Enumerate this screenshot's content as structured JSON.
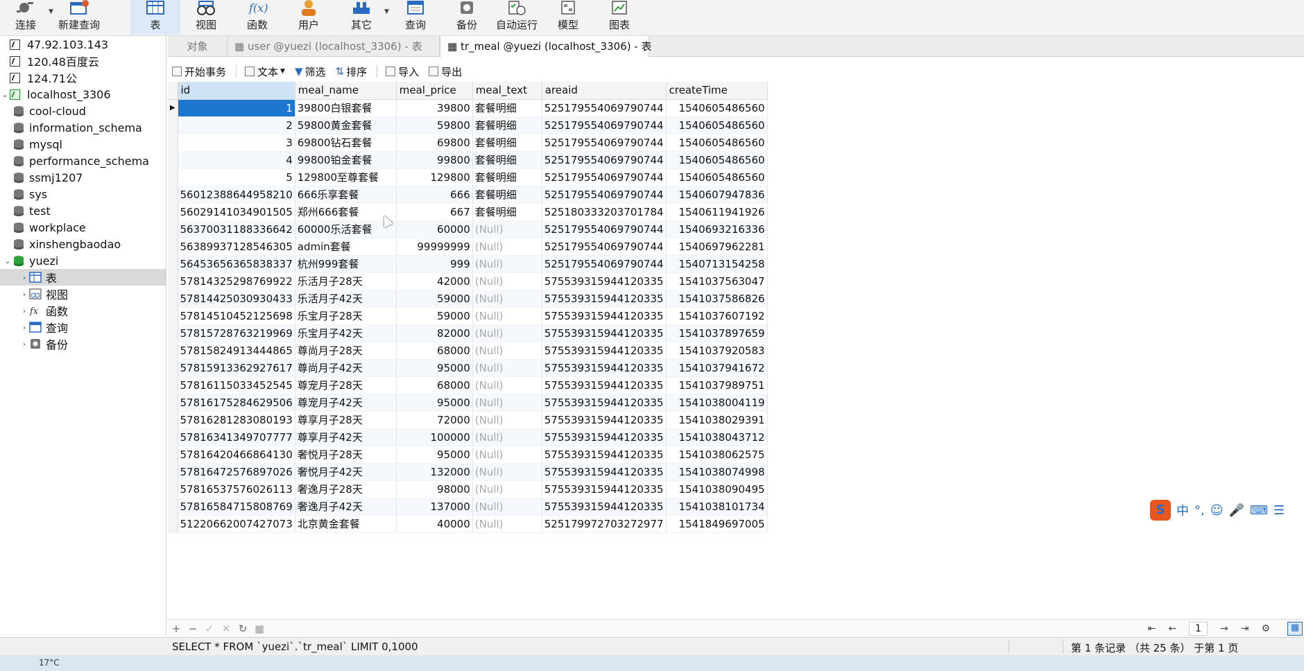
{
  "toolbar": {
    "buttons": [
      {
        "label": "连接",
        "icon": "plug-icon"
      },
      {
        "label": "新建查询",
        "icon": "new-query-icon"
      },
      {
        "label": "表",
        "icon": "table-icon"
      },
      {
        "label": "视图",
        "icon": "view-icon"
      },
      {
        "label": "函数",
        "icon": "function-icon"
      },
      {
        "label": "用户",
        "icon": "user-icon"
      },
      {
        "label": "其它",
        "icon": "other-icon"
      },
      {
        "label": "查询",
        "icon": "query-icon"
      },
      {
        "label": "备份",
        "icon": "backup-icon"
      },
      {
        "label": "自动运行",
        "icon": "schedule-icon"
      },
      {
        "label": "模型",
        "icon": "model-icon"
      },
      {
        "label": "图表",
        "icon": "chart-icon"
      }
    ]
  },
  "sidebar": {
    "connections": [
      "47.92.103.143",
      "120.48百度云",
      "124.71公",
      "localhost_3306"
    ],
    "databases": [
      "cool-cloud",
      "information_schema",
      "mysql",
      "performance_schema",
      "ssmj1207",
      "sys",
      "test",
      "workplace",
      "xinshengbaodao",
      "yuezi"
    ],
    "yuezi_children": [
      "表",
      "视图",
      "函数",
      "查询",
      "备份"
    ]
  },
  "tabs": {
    "objects": "对象",
    "tab1": "user @yuezi (localhost_3306) - 表",
    "tab2": "tr_meal @yuezi (localhost_3306) - 表"
  },
  "subbar": {
    "begin_tx": "开始事务",
    "text": "文本",
    "filter": "筛选",
    "sort": "排序",
    "import": "导入",
    "export": "导出"
  },
  "grid": {
    "columns": [
      "id",
      "meal_name",
      "meal_price",
      "meal_text",
      "areaid",
      "createTime"
    ],
    "rows": [
      [
        "1",
        "39800白银套餐",
        "39800",
        "套餐明细",
        "525179554069790744",
        "1540605486560"
      ],
      [
        "2",
        "59800黄金套餐",
        "59800",
        "套餐明细",
        "525179554069790744",
        "1540605486560"
      ],
      [
        "3",
        "69800钻石套餐",
        "69800",
        "套餐明细",
        "525179554069790744",
        "1540605486560"
      ],
      [
        "4",
        "99800铂金套餐",
        "99800",
        "套餐明细",
        "525179554069790744",
        "1540605486560"
      ],
      [
        "5",
        "129800至尊套餐",
        "129800",
        "套餐明细",
        "525179554069790744",
        "1540605486560"
      ],
      [
        "56012388644958210",
        "666乐享套餐",
        "666",
        "套餐明细",
        "525179554069790744",
        "1540607947836"
      ],
      [
        "56029141034901505",
        "郑州666套餐",
        "667",
        "套餐明细",
        "525180333203701784",
        "1540611941926"
      ],
      [
        "56370031188336642",
        "60000乐活套餐",
        "60000",
        "(Null)",
        "525179554069790744",
        "1540693216336"
      ],
      [
        "56389937128546305",
        "admin套餐",
        "99999999",
        "(Null)",
        "525179554069790744",
        "1540697962281"
      ],
      [
        "56453656365838337",
        "杭州999套餐",
        "999",
        "(Null)",
        "525179554069790744",
        "1540713154258"
      ],
      [
        "57814325298769922",
        "乐活月子28天",
        "42000",
        "(Null)",
        "575539315944120335",
        "1541037563047"
      ],
      [
        "57814425030930433",
        "乐活月子42天",
        "59000",
        "(Null)",
        "575539315944120335",
        "1541037586826"
      ],
      [
        "57814510452125698",
        "乐宝月子28天",
        "59000",
        "(Null)",
        "575539315944120335",
        "1541037607192"
      ],
      [
        "57815728763219969",
        "乐宝月子42天",
        "82000",
        "(Null)",
        "575539315944120335",
        "1541037897659"
      ],
      [
        "57815824913444865",
        "尊尚月子28天",
        "68000",
        "(Null)",
        "575539315944120335",
        "1541037920583"
      ],
      [
        "57815913362927617",
        "尊尚月子42天",
        "95000",
        "(Null)",
        "575539315944120335",
        "1541037941672"
      ],
      [
        "57816115033452545",
        "尊宠月子28天",
        "68000",
        "(Null)",
        "575539315944120335",
        "1541037989751"
      ],
      [
        "57816175284629506",
        "尊宠月子42天",
        "95000",
        "(Null)",
        "575539315944120335",
        "1541038004119"
      ],
      [
        "57816281283080193",
        "尊享月子28天",
        "72000",
        "(Null)",
        "575539315944120335",
        "1541038029391"
      ],
      [
        "57816341349707777",
        "尊享月子42天",
        "100000",
        "(Null)",
        "575539315944120335",
        "1541038043712"
      ],
      [
        "57816420466864130",
        "奢悦月子28天",
        "95000",
        "(Null)",
        "575539315944120335",
        "1541038062575"
      ],
      [
        "57816472576897026",
        "奢悦月子42天",
        "132000",
        "(Null)",
        "575539315944120335",
        "1541038074998"
      ],
      [
        "57816537576026113",
        "奢逸月子28天",
        "98000",
        "(Null)",
        "575539315944120335",
        "1541038090495"
      ],
      [
        "57816584715808769",
        "奢逸月子42天",
        "137000",
        "(Null)",
        "575539315944120335",
        "1541038101734"
      ],
      [
        "51220662007427073",
        "北京黄金套餐",
        "40000",
        "(Null)",
        "525179972703272977",
        "1541849697005"
      ]
    ]
  },
  "pager": {
    "page": "1"
  },
  "status": {
    "sql": "SELECT * FROM `yuezi`.`tr_meal` LIMIT 0,1000",
    "records": "第 1 条记录 （共 25 条） 于第 1 页"
  },
  "taskbar": {
    "temp": "17°C"
  },
  "ime": {
    "logo": "S",
    "mode": "中"
  }
}
